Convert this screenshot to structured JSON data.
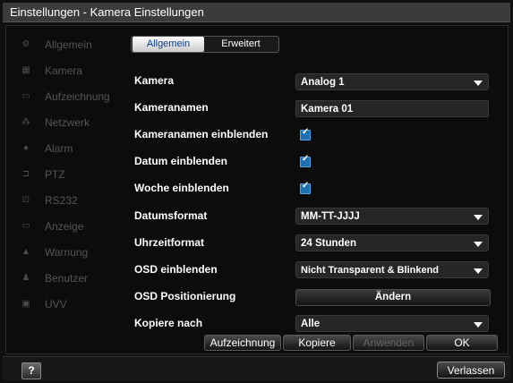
{
  "window": {
    "title": "Einstellungen - Kamera Einstellungen"
  },
  "sidebar": {
    "items": [
      {
        "icon": "gear-icon",
        "label": "Allgemein"
      },
      {
        "icon": "camera-icon",
        "label": "Kamera"
      },
      {
        "icon": "record-icon",
        "label": "Aufzeichnung"
      },
      {
        "icon": "network-icon",
        "label": "Netzwerk"
      },
      {
        "icon": "alarm-icon",
        "label": "Alarm"
      },
      {
        "icon": "ptz-icon",
        "label": "PTZ"
      },
      {
        "icon": "serial-icon",
        "label": "RS232"
      },
      {
        "icon": "monitor-icon",
        "label": "Anzeige"
      },
      {
        "icon": "warning-icon",
        "label": "Warnung"
      },
      {
        "icon": "user-icon",
        "label": "Benutzer"
      },
      {
        "icon": "uvv-icon",
        "label": "UVV"
      }
    ]
  },
  "tabs": {
    "general": "Allgemein",
    "advanced": "Erweitert"
  },
  "form": {
    "camera": {
      "label": "Kamera",
      "value": "Analog 1"
    },
    "camera_name": {
      "label": "Kameranamen",
      "value": "Kamera 01"
    },
    "show_name": {
      "label": "Kameranamen einblenden",
      "checked": true
    },
    "show_date": {
      "label": "Datum einblenden",
      "checked": true
    },
    "show_week": {
      "label": "Woche einblenden",
      "checked": true
    },
    "date_format": {
      "label": "Datumsformat",
      "value": "MM-TT-JJJJ"
    },
    "time_format": {
      "label": "Uhrzeitformat",
      "value": "24 Stunden"
    },
    "osd_show": {
      "label": "OSD einblenden",
      "value": "Nicht Transparent & Blinkend"
    },
    "osd_position": {
      "label": "OSD Positionierung",
      "button": "Ändern"
    },
    "copy_to": {
      "label": "Kopiere nach",
      "value": "Alle"
    }
  },
  "buttons": {
    "record": "Aufzeichnung",
    "copy": "Kopiere",
    "apply": "Anwenden",
    "ok": "OK",
    "exit": "Verlassen",
    "help": "?"
  },
  "colors": {
    "checkbox": "#1e6fb0",
    "tab_text": "#0a3a8a"
  }
}
